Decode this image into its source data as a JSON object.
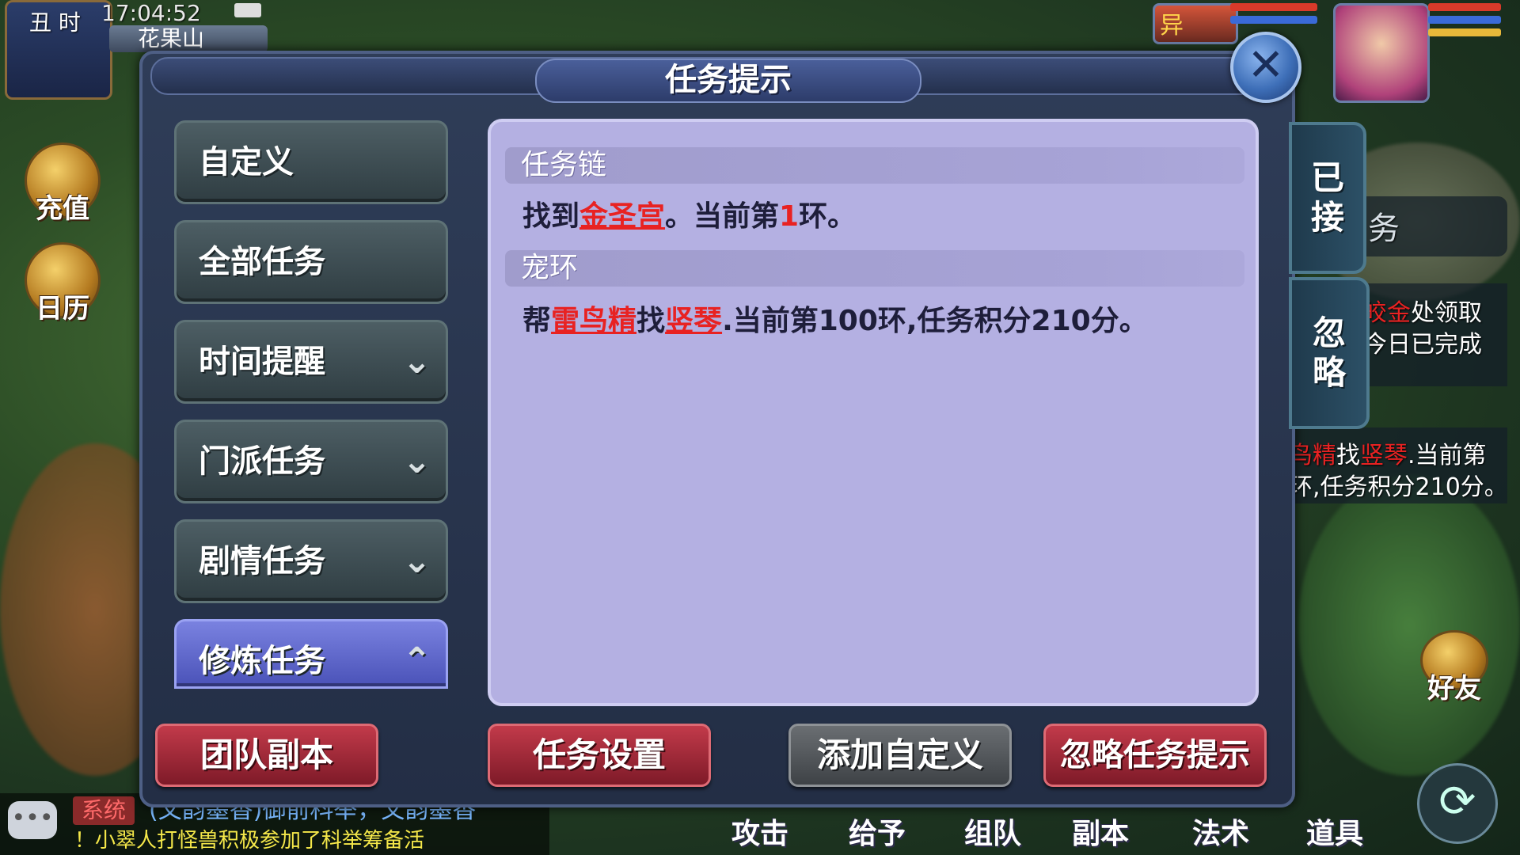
{
  "hud": {
    "time_label": "丑 时",
    "clock": "17:04:52",
    "map_name": "花果山",
    "recharge_label": "充值",
    "calendar_label": "日历",
    "friends_label": "好友",
    "pet_tag": "异"
  },
  "dialog": {
    "title": "任务提示",
    "close_icon": "close-icon"
  },
  "tabs": [
    {
      "label": "自定义",
      "chevron": ""
    },
    {
      "label": "全部任务",
      "chevron": ""
    },
    {
      "label": "时间提醒",
      "chevron": "⌄"
    },
    {
      "label": "门派任务",
      "chevron": "⌄"
    },
    {
      "label": "剧情任务",
      "chevron": "⌄"
    },
    {
      "label": "修炼任务",
      "chevron": "⌃"
    }
  ],
  "content": {
    "sections": [
      {
        "heading": "任务链",
        "text_pre": "找到",
        "link1": "金圣宫",
        "text_mid": "。当前第",
        "num": "1",
        "text_post": "环。"
      },
      {
        "heading": "宠环",
        "text_pre": "帮",
        "link1": "雷鸟精",
        "text_mid": "找",
        "link2": "竖琴",
        "text_post": ".当前第100环,任务积分210分。"
      }
    ]
  },
  "side_tabs": {
    "accepted": "已接",
    "ignore": "忽略"
  },
  "buttons": {
    "team_dungeon": "团队副本",
    "task_settings": "任务设置",
    "add_custom": "添加自定义",
    "ignore_hint": "忽略任务提示"
  },
  "background_panel": {
    "line1_red": "皎金",
    "line1_rest": "处领取",
    "line2": "今日已完成",
    "line3_red1": "鸟精",
    "line3_mid": "找",
    "line3_red2": "竖琴",
    "line3_rest": ".当前第",
    "line4": "环,任务积分210分。",
    "tab_stub": "务"
  },
  "chat": {
    "tag": "系统",
    "line1": "(文韵墨香)御前科举，文韵墨香",
    "line2": "！小翠人打怪兽积极参加了科举筹备活"
  },
  "bottom_menu": [
    "攻击",
    "给予",
    "组队",
    "副本",
    "法术",
    "道具"
  ],
  "colors": {
    "accent_red": "#e82222",
    "panel": "#b4b0e2",
    "active_tab": "#6b72d6"
  }
}
